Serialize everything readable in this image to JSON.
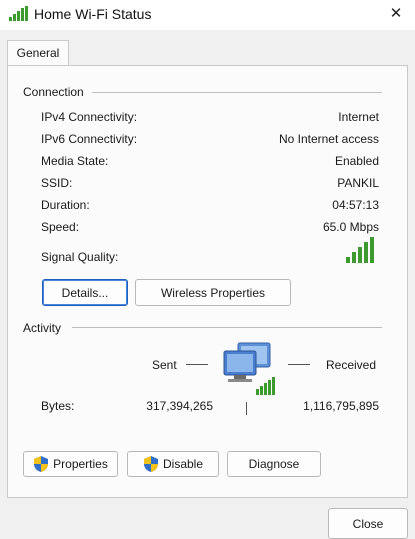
{
  "window": {
    "title": "Home Wi-Fi Status",
    "close_glyph": "✕"
  },
  "tabs": [
    {
      "label": "General",
      "active": true
    }
  ],
  "connection": {
    "title": "Connection",
    "rows": [
      {
        "label": "IPv4 Connectivity:",
        "value": "Internet"
      },
      {
        "label": "IPv6 Connectivity:",
        "value": "No Internet access"
      },
      {
        "label": "Media State:",
        "value": "Enabled"
      },
      {
        "label": "SSID:",
        "value": "PANKIL"
      },
      {
        "label": "Duration:",
        "value": "04:57:13"
      },
      {
        "label": "Speed:",
        "value": "65.0 Mbps"
      }
    ],
    "signal_label": "Signal Quality:",
    "signal_bars": 5,
    "details_button": "Details...",
    "wireless_button": "Wireless Properties"
  },
  "activity": {
    "title": "Activity",
    "sent_label": "Sent",
    "received_label": "Received",
    "bytes_label": "Bytes:",
    "bytes_sent": "317,394,265",
    "bytes_received": "1,116,795,895",
    "properties_button": "Properties",
    "disable_button": "Disable",
    "diagnose_button": "Diagnose"
  },
  "footer": {
    "close_button": "Close"
  },
  "colors": {
    "signal_green": "#3c9a2e",
    "shield_blue": "#2f6fc9",
    "shield_yellow": "#f2c21b"
  }
}
